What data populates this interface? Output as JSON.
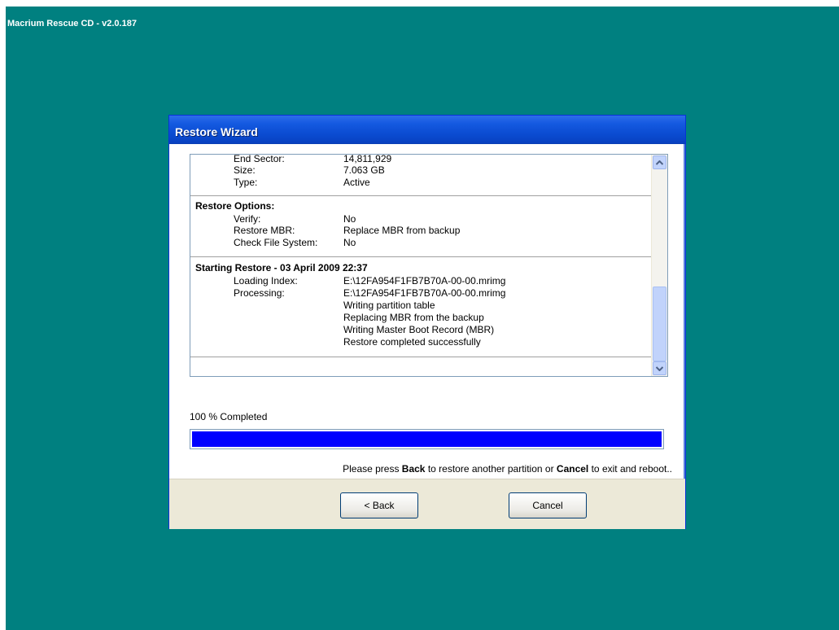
{
  "app": {
    "title": "Macrium Rescue CD - v2.0.187"
  },
  "window": {
    "title": "Restore Wizard"
  },
  "log": {
    "partition_rows": [
      {
        "label": "End Sector:",
        "value": "14,811,929"
      },
      {
        "label": "Size:",
        "value": "7.063 GB"
      },
      {
        "label": "Type:",
        "value": "Active"
      }
    ],
    "restore_options": {
      "heading": "Restore Options:",
      "rows": [
        {
          "label": "Verify:",
          "value": "No"
        },
        {
          "label": "Restore MBR:",
          "value": "Replace MBR from backup"
        },
        {
          "label": "Check File System:",
          "value": "No"
        }
      ]
    },
    "starting_restore": {
      "heading": "Starting Restore - 03 April 2009  22:37",
      "rows": [
        {
          "label": "Loading Index:",
          "value": "E:\\12FA954F1FB7B70A-00-00.mrimg"
        },
        {
          "label": "Processing:",
          "value": "E:\\12FA954F1FB7B70A-00-00.mrimg"
        },
        {
          "label": "",
          "value": "Writing partition table"
        },
        {
          "label": "",
          "value": "Replacing MBR from the backup"
        },
        {
          "label": "",
          "value": "Writing Master Boot Record (MBR)"
        },
        {
          "label": "",
          "value": "Restore completed successfully"
        }
      ]
    }
  },
  "progress": {
    "label": "100 % Completed",
    "percent": 100
  },
  "instruction": {
    "pre": "Please press ",
    "back_word": "Back",
    "mid": " to restore another partition or ",
    "cancel_word": "Cancel",
    "post": " to exit and reboot.."
  },
  "buttons": {
    "back_label": "< Back",
    "cancel_label": "Cancel"
  },
  "colors": {
    "desktop": "#008080",
    "titlebar": "#0a4bd0",
    "progress_fill": "#0000ff"
  },
  "icons": {
    "scroll_up": "chevron-up-icon",
    "scroll_down": "chevron-down-icon"
  }
}
